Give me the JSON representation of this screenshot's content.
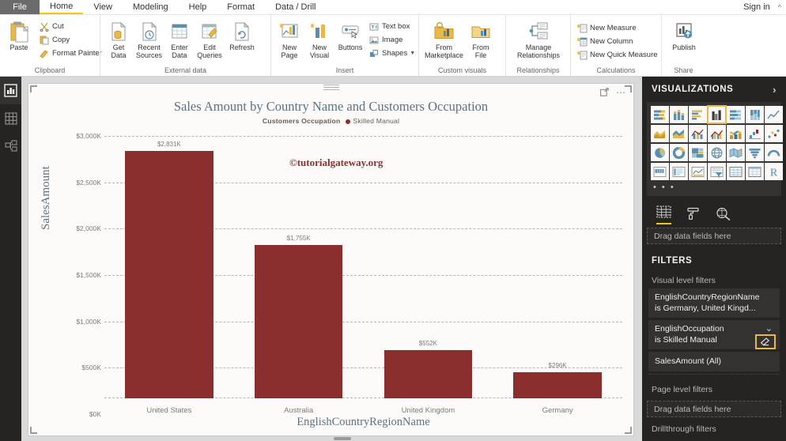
{
  "menubar": {
    "file_label": "File",
    "tabs": [
      {
        "label": "Home",
        "active": true
      },
      {
        "label": "View",
        "active": false
      },
      {
        "label": "Modeling",
        "active": false
      },
      {
        "label": "Help",
        "active": false
      },
      {
        "label": "Format",
        "active": false
      },
      {
        "label": "Data / Drill",
        "active": false
      }
    ],
    "signin_label": "Sign in",
    "collapse_icon": "chevron-up-icon"
  },
  "ribbon": {
    "groups": [
      {
        "name": "clipboard",
        "label": "Clipboard",
        "big": [
          {
            "label": "Paste",
            "icon": "paste-icon"
          }
        ],
        "small": [
          {
            "label": "Cut",
            "icon": "scissors-icon"
          },
          {
            "label": "Copy",
            "icon": "copy-icon"
          },
          {
            "label": "Format Painter",
            "icon": "format-painter-icon"
          }
        ]
      },
      {
        "name": "external-data",
        "label": "External data",
        "big": [
          {
            "label": "Get\nData",
            "icon": "get-data-icon",
            "dropdown": true
          },
          {
            "label": "Recent\nSources",
            "icon": "recent-sources-icon",
            "dropdown": true
          },
          {
            "label": "Enter\nData",
            "icon": "enter-data-icon",
            "dropdown": false
          },
          {
            "label": "Edit\nQueries",
            "icon": "edit-queries-icon",
            "dropdown": true
          },
          {
            "label": "Refresh",
            "icon": "refresh-icon",
            "dropdown": false
          }
        ],
        "small": []
      },
      {
        "name": "insert",
        "label": "Insert",
        "big": [
          {
            "label": "New\nPage",
            "icon": "new-page-icon",
            "dropdown": true
          },
          {
            "label": "New\nVisual",
            "icon": "new-visual-icon",
            "dropdown": false
          },
          {
            "label": "Buttons",
            "icon": "buttons-icon",
            "dropdown": true
          }
        ],
        "small": [
          {
            "label": "Text box",
            "icon": "text-box-icon"
          },
          {
            "label": "Image",
            "icon": "image-icon"
          },
          {
            "label": "Shapes",
            "icon": "shapes-icon",
            "dropdown": true
          }
        ]
      },
      {
        "name": "custom-visuals",
        "label": "Custom visuals",
        "big": [
          {
            "label": "From\nMarketplace",
            "icon": "marketplace-icon",
            "dropdown": false
          },
          {
            "label": "From\nFile",
            "icon": "from-file-icon",
            "dropdown": false
          }
        ],
        "small": []
      },
      {
        "name": "relationships",
        "label": "Relationships",
        "big": [
          {
            "label": "Manage\nRelationships",
            "icon": "manage-relationships-icon",
            "dropdown": false
          }
        ],
        "small": []
      },
      {
        "name": "calculations",
        "label": "Calculations",
        "big": [],
        "small": [
          {
            "label": "New Measure",
            "icon": "new-measure-icon"
          },
          {
            "label": "New Column",
            "icon": "new-column-icon"
          },
          {
            "label": "New Quick Measure",
            "icon": "new-quick-measure-icon"
          }
        ]
      },
      {
        "name": "share",
        "label": "Share",
        "big": [
          {
            "label": "Publish",
            "icon": "publish-icon",
            "dropdown": false
          }
        ],
        "small": []
      }
    ]
  },
  "leftrail": {
    "items": [
      {
        "name": "report-view",
        "icon": "report-bar-chart-icon",
        "active": true
      },
      {
        "name": "data-view",
        "icon": "data-table-icon",
        "active": false
      },
      {
        "name": "model-view",
        "icon": "model-relationship-icon",
        "active": false
      }
    ]
  },
  "visual": {
    "focus_mode_icon": "focus-mode-icon",
    "more_options_icon": "more-options-ellipsis-icon"
  },
  "watermark": "©tutorialgateway.org",
  "chart_data": {
    "type": "bar",
    "title": "Sales Amount by Country Name and Customers Occupation",
    "categories": [
      "United States",
      "Australia",
      "United Kingdom",
      "Germany"
    ],
    "values": [
      2831,
      1755,
      552,
      296
    ],
    "data_labels": [
      "$2,831K",
      "$1,755K",
      "$552K",
      "$296K"
    ],
    "xlabel": "EnglishCountryRegionName",
    "ylabel": "SalesAmount",
    "ylim": [
      0,
      3000
    ],
    "yticks": [
      3000,
      2500,
      2000,
      1500,
      1000,
      500,
      0
    ],
    "ytick_labels": [
      "$3,000K",
      "$2,500K",
      "$2,000K",
      "$1,500K",
      "$1,000K",
      "$500K",
      "$0K"
    ],
    "grid": true,
    "legend_position": "top",
    "legend_title": "Customers Occupation",
    "legend_entries": [
      {
        "name": "Skilled Manual",
        "color": "#8b2e2e"
      }
    ],
    "series_color": "#8b2e2e",
    "title_color": "#5b7286"
  },
  "visualizations": {
    "header": "VISUALIZATIONS",
    "expand_icon": "chevron-right-icon",
    "icons": [
      "stacked-bar-chart-icon",
      "stacked-column-chart-icon",
      "clustered-bar-chart-icon",
      "clustered-column-chart-icon",
      "100-stacked-bar-chart-icon",
      "100-stacked-column-chart-icon",
      "line-chart-icon",
      "area-chart-icon",
      "stacked-area-chart-icon",
      "line-stacked-column-chart-icon",
      "line-clustered-column-chart-icon",
      "ribbon-chart-icon",
      "waterfall-chart-icon",
      "scatter-chart-icon",
      "pie-chart-icon",
      "donut-chart-icon",
      "treemap-icon",
      "map-icon",
      "filled-map-icon",
      "funnel-chart-icon",
      "gauge-chart-icon",
      "card-icon",
      "multi-row-card-icon",
      "kpi-icon",
      "slicer-icon",
      "table-icon",
      "matrix-icon",
      "r-script-visual-icon"
    ],
    "selected_index": 3,
    "more_icon": "more-visuals-ellipsis-icon",
    "field_tabs": [
      {
        "name": "fields-tab",
        "icon": "fields-table-icon",
        "active": true
      },
      {
        "name": "format-tab",
        "icon": "format-paint-roller-icon",
        "active": false
      },
      {
        "name": "analytics-tab",
        "icon": "analytics-magnifier-icon",
        "active": false
      }
    ],
    "dropzone_label": "Drag data fields here"
  },
  "filters": {
    "header": "FILTERS",
    "visual_level": {
      "label": "Visual level filters",
      "cards": [
        {
          "name": "filter-card-country",
          "line1": "EnglishCountryRegionName",
          "line2": "is Germany, United Kingd...",
          "has_chevron": false,
          "has_eraser": false
        },
        {
          "name": "filter-card-occupation",
          "line1": "EnglishOccupation",
          "line2": "is Skilled Manual",
          "has_chevron": true,
          "chevron_icon": "chevron-down-icon",
          "has_eraser": true,
          "eraser_icon": "eraser-clear-filter-icon",
          "highlight_color": "#e8b84b"
        },
        {
          "name": "filter-card-salesamount",
          "line1": "SalesAmount  (All)",
          "line2": "",
          "has_chevron": false,
          "has_eraser": false
        }
      ]
    },
    "page_level": {
      "label": "Page level filters",
      "dropzone_label": "Drag data fields here"
    },
    "drillthrough": {
      "label": "Drillthrough filters"
    }
  }
}
